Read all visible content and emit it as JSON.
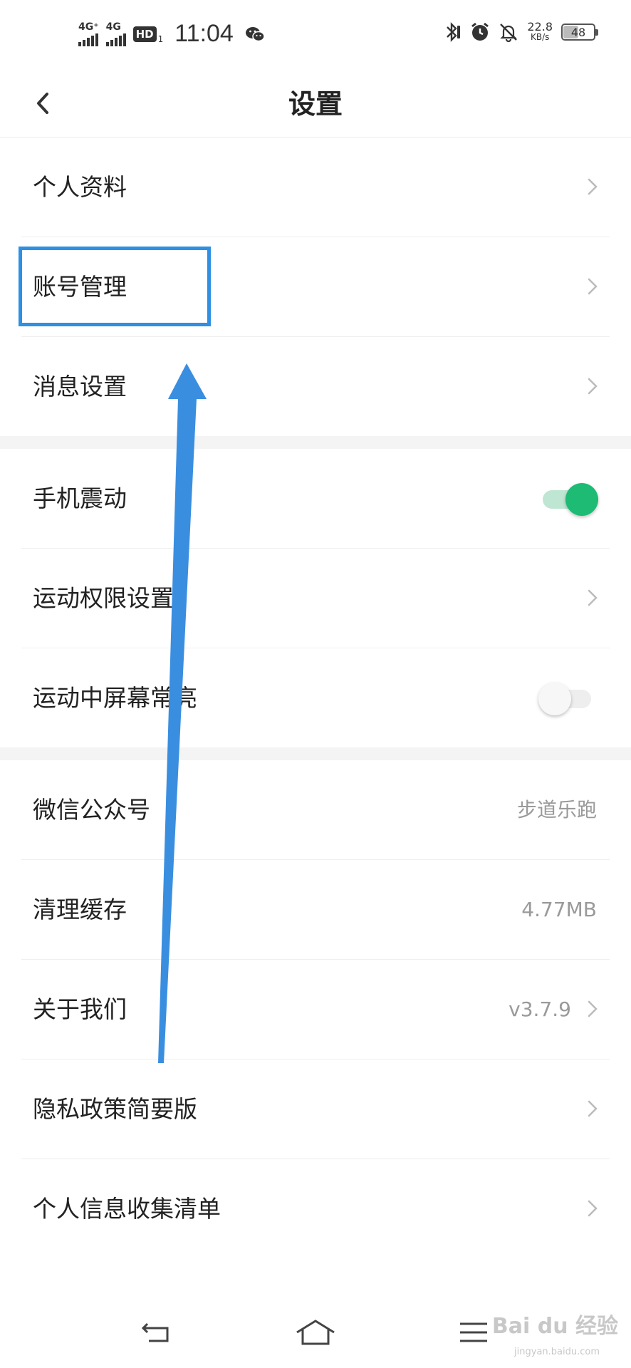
{
  "status_bar": {
    "network1": "4G⁺",
    "network2": "4G",
    "hd": "HD",
    "hd_sub": "1",
    "time": "11:04",
    "speed_value": "22.8",
    "speed_unit": "KB/s",
    "battery": "48",
    "battery_level": 0.48,
    "icons": [
      "signal-icon",
      "hd-voice-icon",
      "wechat-icon",
      "bluetooth-icon",
      "alarm-icon",
      "bell-off-icon",
      "battery-icon"
    ]
  },
  "header": {
    "title": "设置",
    "back_icon": "back-chevron-icon"
  },
  "sections": [
    {
      "items": [
        {
          "label": "个人资料",
          "control": "chevron"
        },
        {
          "label": "账号管理",
          "control": "chevron"
        },
        {
          "label": "消息设置",
          "control": "chevron"
        }
      ]
    },
    {
      "items": [
        {
          "label": "手机震动",
          "control": "toggle",
          "on": true
        },
        {
          "label": "运动权限设置",
          "control": "chevron"
        },
        {
          "label": "运动中屏幕常亮",
          "control": "toggle",
          "on": false
        }
      ]
    },
    {
      "items": [
        {
          "label": "微信公众号",
          "value": "步道乐跑",
          "control": "none"
        },
        {
          "label": "清理缓存",
          "value": "4.77MB",
          "control": "none"
        },
        {
          "label": "关于我们",
          "value": "v3.7.9",
          "control": "chevron"
        },
        {
          "label": "隐私政策简要版",
          "control": "chevron"
        },
        {
          "label": "个人信息收集清单",
          "control": "chevron"
        }
      ]
    }
  ],
  "colors": {
    "accent_green": "#1dbb74",
    "annotation_blue": "#2f8fe2",
    "section_gap": "#f4f4f4"
  },
  "watermark": {
    "brand": "Bai du 经验",
    "url": "jingyan.baidu.com"
  },
  "nav_bar": {
    "icons": [
      "back-nav-icon",
      "home-nav-icon",
      "menu-nav-icon"
    ]
  }
}
